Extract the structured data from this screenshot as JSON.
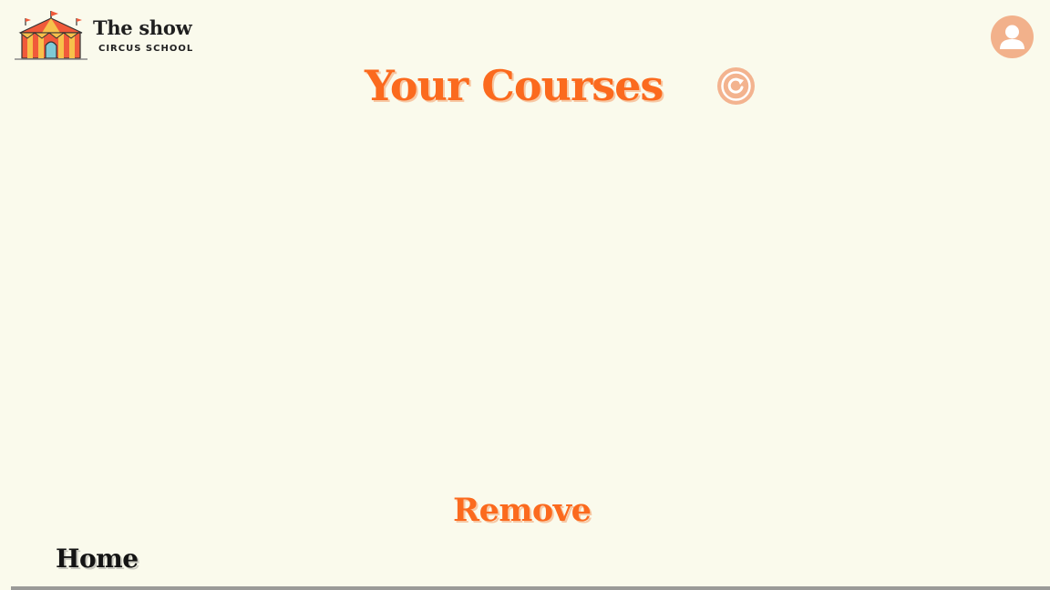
{
  "brand": {
    "title": "The show",
    "subtitle": "CIRCUS SCHOOL",
    "logo_icon": "circus-tent-icon"
  },
  "header": {
    "user_icon": "user-avatar-icon"
  },
  "main": {
    "title": "Your Courses",
    "refresh_icon": "refresh-icon",
    "remove_label": "Remove"
  },
  "footer": {
    "home_label": "Home"
  },
  "colors": {
    "background": "#fafaec",
    "accent": "#fb6a1e",
    "accent_light": "#f3b38f",
    "text_dark": "#141414",
    "bar": "#9a9a98"
  }
}
